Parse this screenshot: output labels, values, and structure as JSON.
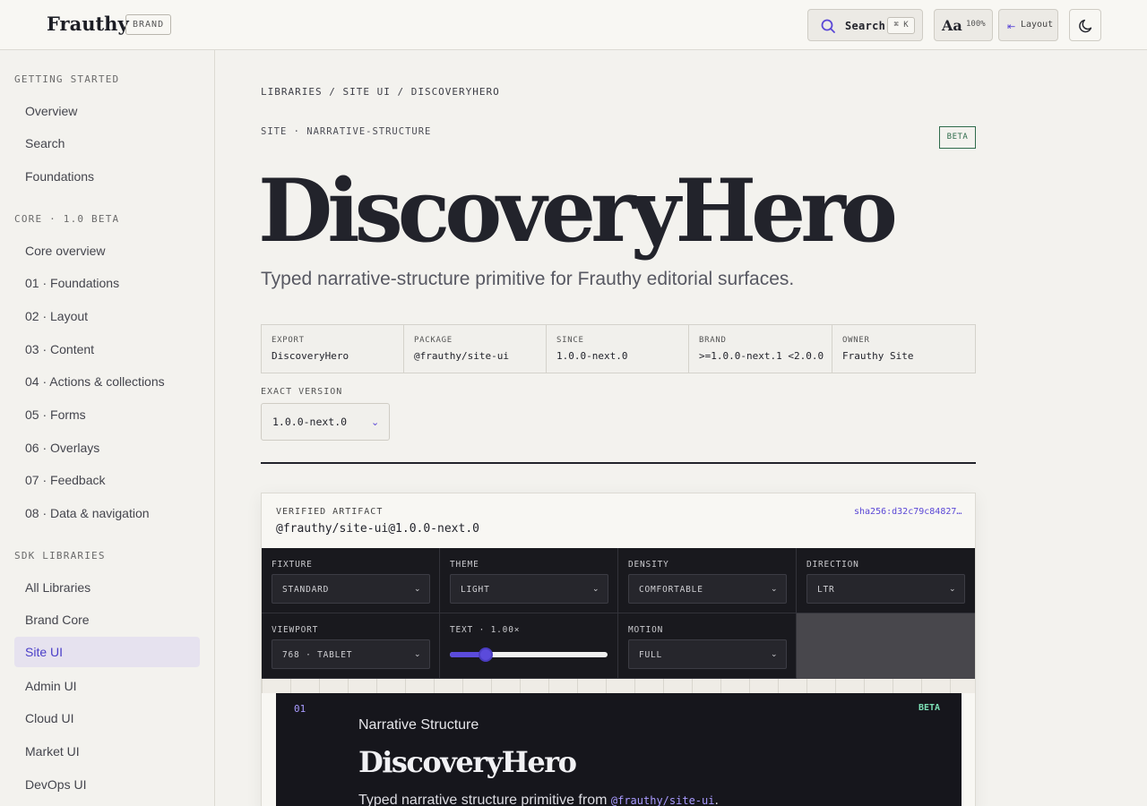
{
  "header": {
    "logo": "Frauthy",
    "brand_badge": "BRAND",
    "search_label": "Search",
    "search_shortcut": "⌘ K",
    "type_label": "Aa",
    "type_scale": "100%",
    "layout_label": "Layout",
    "accent_color": "#5a47d6"
  },
  "sidebar": {
    "sections": [
      {
        "title": "GETTING STARTED",
        "items": [
          "Overview",
          "Search",
          "Foundations"
        ]
      },
      {
        "title": "CORE · 1.0 BETA",
        "items": [
          "Core overview",
          "01 · Foundations",
          "02 · Layout",
          "03 · Content",
          "04 · Actions & collections",
          "05 · Forms",
          "06 · Overlays",
          "07 · Feedback",
          "08 · Data & navigation"
        ]
      },
      {
        "title": "SDK LIBRARIES",
        "items": [
          "All Libraries",
          "Brand Core",
          "Site UI",
          "Admin UI",
          "Cloud UI",
          "Market UI",
          "DevOps UI"
        ]
      }
    ],
    "active_item": "Site UI"
  },
  "main": {
    "breadcrumb": "LIBRARIES / SITE UI / DISCOVERYHERO",
    "eyebrow": "SITE · NARRATIVE-STRUCTURE",
    "status_badge": "BETA",
    "title": "DiscoveryHero",
    "subtitle": "Typed narrative-structure primitive for Frauthy editorial surfaces.",
    "meta": [
      {
        "key": "EXPORT",
        "value": "DiscoveryHero"
      },
      {
        "key": "PACKAGE",
        "value": "@frauthy/site-ui"
      },
      {
        "key": "SINCE",
        "value": "1.0.0-next.0"
      },
      {
        "key": "BRAND",
        "value": ">=1.0.0-next.1 <2.0.0"
      },
      {
        "key": "OWNER",
        "value": "Frauthy Site"
      }
    ],
    "exact_version_label": "EXACT VERSION",
    "exact_version_value": "1.0.0-next.0"
  },
  "artifact": {
    "eyebrow": "VERIFIED ARTIFACT",
    "package": "@frauthy/site-ui@1.0.0-next.0",
    "hash": "sha256:d32c79c84827…",
    "controls": {
      "fixture": {
        "label": "FIXTURE",
        "value": "STANDARD"
      },
      "theme": {
        "label": "THEME",
        "value": "LIGHT"
      },
      "density": {
        "label": "DENSITY",
        "value": "COMFORTABLE"
      },
      "direction": {
        "label": "DIRECTION",
        "value": "LTR"
      },
      "viewport": {
        "label": "VIEWPORT",
        "value": "768 · TABLET"
      },
      "text": {
        "label": "TEXT · 1.00×",
        "level": 0.23
      },
      "motion": {
        "label": "MOTION",
        "value": "FULL"
      }
    },
    "preview": {
      "number": "01",
      "badge": "BETA",
      "eyebrow": "Narrative Structure",
      "title": "DiscoveryHero",
      "subtitle_prefix": "Typed narrative structure primitive from ",
      "subtitle_code": "@frauthy/site-ui",
      "subtitle_suffix": "."
    }
  }
}
